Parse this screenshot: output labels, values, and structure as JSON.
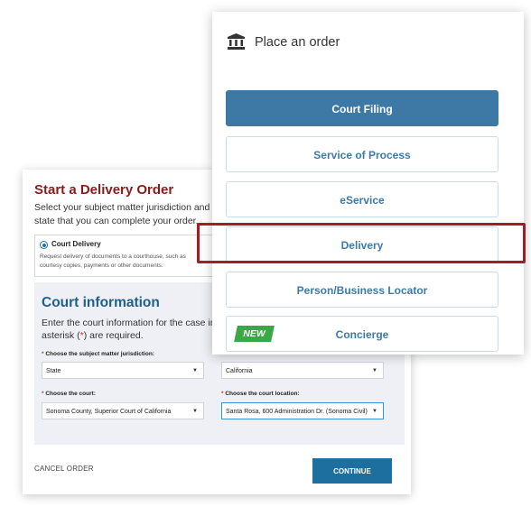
{
  "delivery_form": {
    "title": "Start a Delivery Order",
    "intro": "Select your subject matter jurisdiction and state that you can complete your order.",
    "option": {
      "label": "Court Delivery",
      "description": "Request delivery of documents to a courthouse, such as courtesy copies, payments or other documents."
    },
    "court": {
      "heading": "Court information",
      "desc_start": "Enter the court information for the case in wh asterisk (",
      "desc_asterisk": "*",
      "desc_end": ") are required.",
      "fields": {
        "jurisdiction_label": "Choose the subject matter jurisdiction:",
        "jurisdiction_value": "State",
        "state_value": "California",
        "court_label": "Choose the court:",
        "court_value": "Sonoma County, Superior Court of California",
        "location_label": "Choose the court location:",
        "location_value": "Santa Rosa, 600 Administration Dr. (Sonoma Civil)"
      }
    },
    "cancel_label": "CANCEL ORDER",
    "continue_label": "CONTINUE"
  },
  "order_menu": {
    "title": "Place an order",
    "icon": "courthouse-icon",
    "items": [
      {
        "label": "Court Filing"
      },
      {
        "label": "Service of Process"
      },
      {
        "label": "eService"
      },
      {
        "label": "Delivery"
      },
      {
        "label": "Person/Business Locator"
      },
      {
        "label": "Concierge",
        "badge": "NEW"
      }
    ]
  },
  "colors": {
    "accent": "#3e78a5",
    "title_red": "#8b1b1b",
    "highlight": "#9e1f24",
    "badge_green": "#3aa845"
  }
}
